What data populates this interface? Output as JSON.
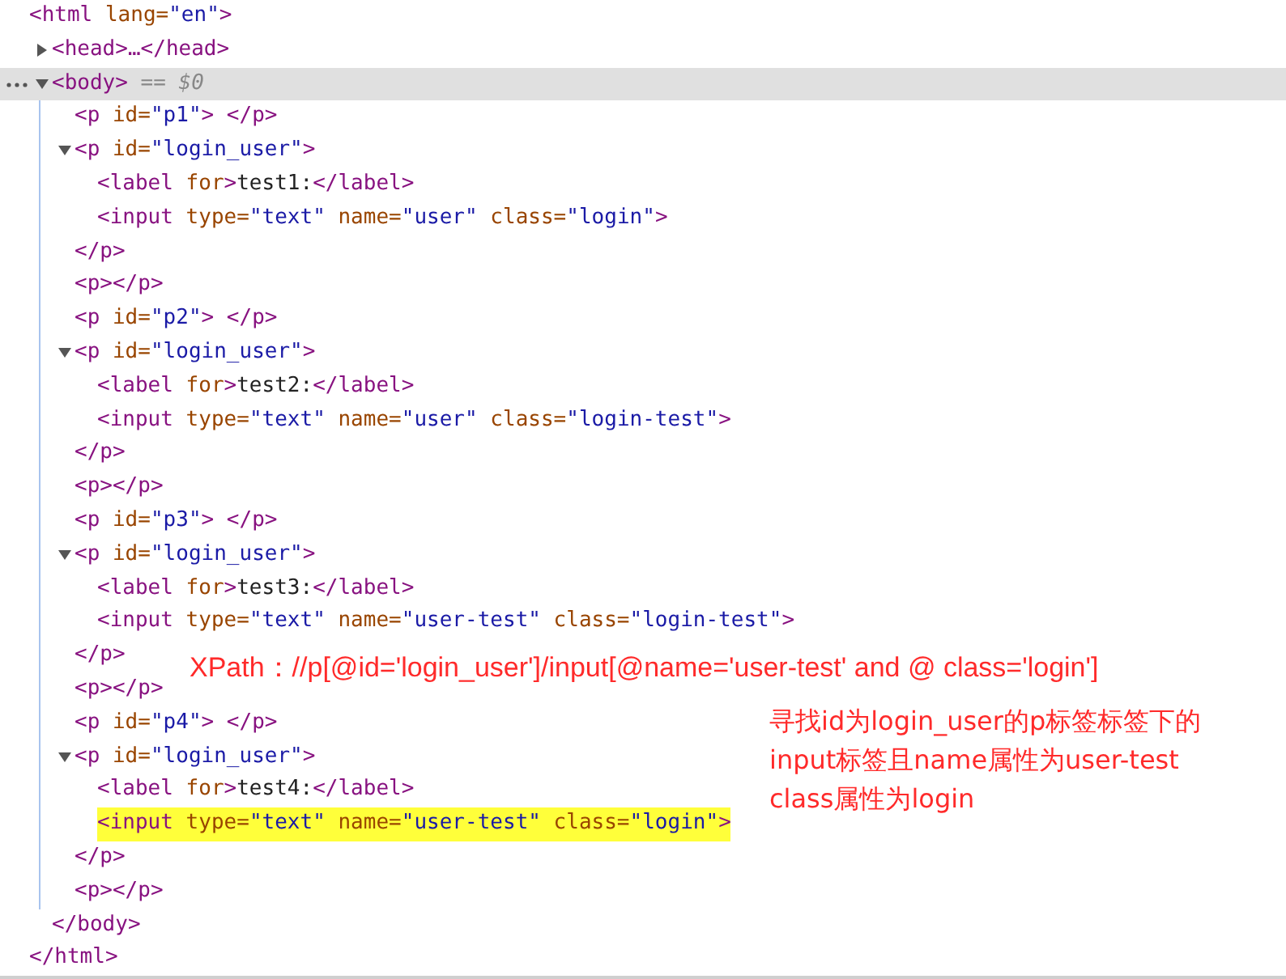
{
  "dom_tree": {
    "line": [
      {
        "kind": "tag",
        "text": "<html "
      },
      {
        "kind": "attr",
        "text": "lang="
      },
      {
        "kind": "value",
        "text": "\"en\""
      },
      {
        "kind": "tag",
        "text": ">"
      }
    ],
    "close": [
      {
        "kind": "tag",
        "text": "</html>"
      }
    ],
    "children": [
      {
        "expanded": false,
        "selected": false,
        "line": [
          {
            "kind": "tag",
            "text": "<head>…</head>"
          }
        ]
      },
      {
        "expanded": true,
        "selected": true,
        "line": [
          {
            "kind": "tag",
            "text": "<body>"
          },
          {
            "kind": "ref",
            "text": " == $0"
          }
        ],
        "close": [
          {
            "kind": "tag",
            "text": "</body>"
          }
        ],
        "children": [
          {
            "line": [
              {
                "kind": "tag",
                "text": "<p "
              },
              {
                "kind": "attr",
                "text": "id="
              },
              {
                "kind": "value",
                "text": "\"p1\""
              },
              {
                "kind": "tag",
                "text": "> </p>"
              }
            ]
          },
          {
            "expanded": true,
            "line": [
              {
                "kind": "tag",
                "text": "<p "
              },
              {
                "kind": "attr",
                "text": "id="
              },
              {
                "kind": "value",
                "text": "\"login_user\""
              },
              {
                "kind": "tag",
                "text": ">"
              }
            ],
            "close": [
              {
                "kind": "tag",
                "text": "</p>"
              }
            ],
            "children": [
              {
                "line": [
                  {
                    "kind": "tag",
                    "text": "<label "
                  },
                  {
                    "kind": "attr",
                    "text": "for"
                  },
                  {
                    "kind": "tag",
                    "text": ">"
                  },
                  {
                    "kind": "text",
                    "text": "test1:"
                  },
                  {
                    "kind": "tag",
                    "text": "</label>"
                  }
                ]
              },
              {
                "line": [
                  {
                    "kind": "tag",
                    "text": "<input "
                  },
                  {
                    "kind": "attr",
                    "text": "type="
                  },
                  {
                    "kind": "value",
                    "text": "\"text\""
                  },
                  {
                    "kind": "attr",
                    "text": " name="
                  },
                  {
                    "kind": "value",
                    "text": "\"user\""
                  },
                  {
                    "kind": "attr",
                    "text": " class="
                  },
                  {
                    "kind": "value",
                    "text": "\"login\""
                  },
                  {
                    "kind": "tag",
                    "text": ">"
                  }
                ]
              }
            ]
          },
          {
            "line": [
              {
                "kind": "tag",
                "text": "<p></p>"
              }
            ]
          },
          {
            "line": [
              {
                "kind": "tag",
                "text": "<p "
              },
              {
                "kind": "attr",
                "text": "id="
              },
              {
                "kind": "value",
                "text": "\"p2\""
              },
              {
                "kind": "tag",
                "text": "> </p>"
              }
            ]
          },
          {
            "expanded": true,
            "line": [
              {
                "kind": "tag",
                "text": "<p "
              },
              {
                "kind": "attr",
                "text": "id="
              },
              {
                "kind": "value",
                "text": "\"login_user\""
              },
              {
                "kind": "tag",
                "text": ">"
              }
            ],
            "close": [
              {
                "kind": "tag",
                "text": "</p>"
              }
            ],
            "children": [
              {
                "line": [
                  {
                    "kind": "tag",
                    "text": "<label "
                  },
                  {
                    "kind": "attr",
                    "text": "for"
                  },
                  {
                    "kind": "tag",
                    "text": ">"
                  },
                  {
                    "kind": "text",
                    "text": "test2:"
                  },
                  {
                    "kind": "tag",
                    "text": "</label>"
                  }
                ]
              },
              {
                "line": [
                  {
                    "kind": "tag",
                    "text": "<input "
                  },
                  {
                    "kind": "attr",
                    "text": "type="
                  },
                  {
                    "kind": "value",
                    "text": "\"text\""
                  },
                  {
                    "kind": "attr",
                    "text": " name="
                  },
                  {
                    "kind": "value",
                    "text": "\"user\""
                  },
                  {
                    "kind": "attr",
                    "text": " class="
                  },
                  {
                    "kind": "value",
                    "text": "\"login-test\""
                  },
                  {
                    "kind": "tag",
                    "text": ">"
                  }
                ]
              }
            ]
          },
          {
            "line": [
              {
                "kind": "tag",
                "text": "<p></p>"
              }
            ]
          },
          {
            "line": [
              {
                "kind": "tag",
                "text": "<p "
              },
              {
                "kind": "attr",
                "text": "id="
              },
              {
                "kind": "value",
                "text": "\"p3\""
              },
              {
                "kind": "tag",
                "text": "> </p>"
              }
            ]
          },
          {
            "expanded": true,
            "line": [
              {
                "kind": "tag",
                "text": "<p "
              },
              {
                "kind": "attr",
                "text": "id="
              },
              {
                "kind": "value",
                "text": "\"login_user\""
              },
              {
                "kind": "tag",
                "text": ">"
              }
            ],
            "close": [
              {
                "kind": "tag",
                "text": "</p>"
              }
            ],
            "children": [
              {
                "line": [
                  {
                    "kind": "tag",
                    "text": "<label "
                  },
                  {
                    "kind": "attr",
                    "text": "for"
                  },
                  {
                    "kind": "tag",
                    "text": ">"
                  },
                  {
                    "kind": "text",
                    "text": "test3:"
                  },
                  {
                    "kind": "tag",
                    "text": "</label>"
                  }
                ]
              },
              {
                "line": [
                  {
                    "kind": "tag",
                    "text": "<input "
                  },
                  {
                    "kind": "attr",
                    "text": "type="
                  },
                  {
                    "kind": "value",
                    "text": "\"text\""
                  },
                  {
                    "kind": "attr",
                    "text": " name="
                  },
                  {
                    "kind": "value",
                    "text": "\"user-test\""
                  },
                  {
                    "kind": "attr",
                    "text": " class="
                  },
                  {
                    "kind": "value",
                    "text": "\"login-test\""
                  },
                  {
                    "kind": "tag",
                    "text": ">"
                  }
                ]
              }
            ]
          },
          {
            "line": [
              {
                "kind": "tag",
                "text": "<p></p>"
              }
            ]
          },
          {
            "line": [
              {
                "kind": "tag",
                "text": "<p "
              },
              {
                "kind": "attr",
                "text": "id="
              },
              {
                "kind": "value",
                "text": "\"p4\""
              },
              {
                "kind": "tag",
                "text": "> </p>"
              }
            ]
          },
          {
            "expanded": true,
            "line": [
              {
                "kind": "tag",
                "text": "<p "
              },
              {
                "kind": "attr",
                "text": "id="
              },
              {
                "kind": "value",
                "text": "\"login_user\""
              },
              {
                "kind": "tag",
                "text": ">"
              }
            ],
            "close": [
              {
                "kind": "tag",
                "text": "</p>"
              }
            ],
            "children": [
              {
                "line": [
                  {
                    "kind": "tag",
                    "text": "<label "
                  },
                  {
                    "kind": "attr",
                    "text": "for"
                  },
                  {
                    "kind": "tag",
                    "text": ">"
                  },
                  {
                    "kind": "text",
                    "text": "test4:"
                  },
                  {
                    "kind": "tag",
                    "text": "</label>"
                  }
                ]
              },
              {
                "highlighted": true,
                "line": [
                  {
                    "kind": "tag",
                    "text": "<input "
                  },
                  {
                    "kind": "attr",
                    "text": "type="
                  },
                  {
                    "kind": "value",
                    "text": "\"text\""
                  },
                  {
                    "kind": "attr",
                    "text": " name="
                  },
                  {
                    "kind": "value",
                    "text": "\"user-test\""
                  },
                  {
                    "kind": "attr",
                    "text": " class="
                  },
                  {
                    "kind": "value",
                    "text": "\"login\""
                  },
                  {
                    "kind": "tag",
                    "text": ">"
                  }
                ]
              }
            ]
          },
          {
            "line": [
              {
                "kind": "tag",
                "text": "<p></p>"
              }
            ]
          }
        ]
      }
    ]
  },
  "annotations": {
    "xpath": "XPath：//p[@id='login_user']/input[@name='user-test' and @ class='login']",
    "explanation_lines": [
      "寻找id为login_user的p标签标签下的",
      "input标签且name属性为user-test",
      "class属性为login"
    ]
  }
}
